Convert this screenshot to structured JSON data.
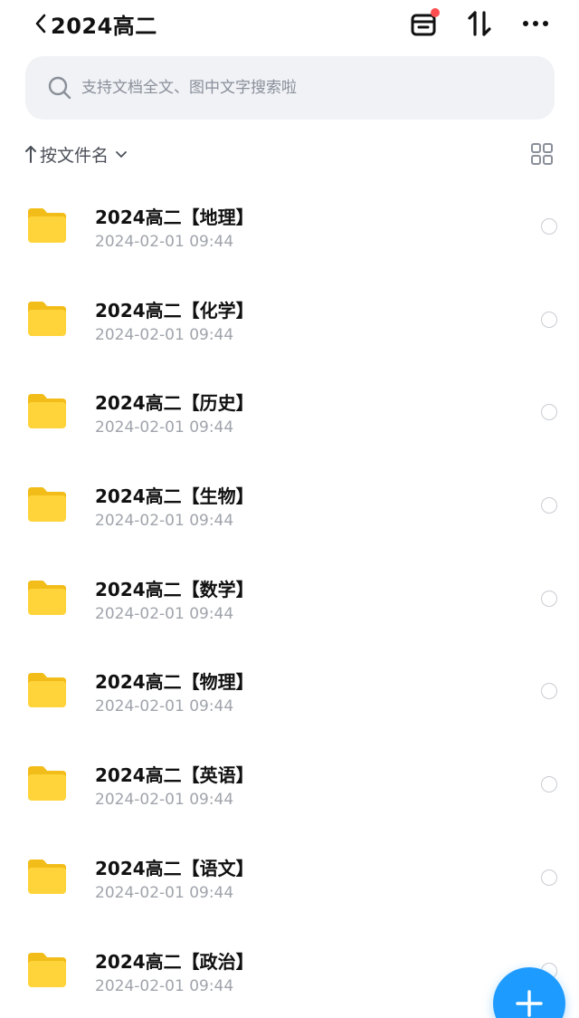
{
  "header": {
    "title": "2024高二",
    "icons": [
      "back-icon",
      "basket-icon",
      "sort-toggle-icon",
      "more-icon"
    ],
    "badge_color": "#ff4d4f"
  },
  "search": {
    "placeholder": "支持文档全文、图中文字搜索啦"
  },
  "sort": {
    "label": "按文件名"
  },
  "files": [
    {
      "name": "2024高二【地理】",
      "date": "2024-02-01 09:44"
    },
    {
      "name": "2024高二【化学】",
      "date": "2024-02-01 09:44"
    },
    {
      "name": "2024高二【历史】",
      "date": "2024-02-01 09:44"
    },
    {
      "name": "2024高二【生物】",
      "date": "2024-02-01 09:44"
    },
    {
      "name": "2024高二【数学】",
      "date": "2024-02-01 09:44"
    },
    {
      "name": "2024高二【物理】",
      "date": "2024-02-01 09:44"
    },
    {
      "name": "2024高二【英语】",
      "date": "2024-02-01 09:44"
    },
    {
      "name": "2024高二【语文】",
      "date": "2024-02-01 09:44"
    },
    {
      "name": "2024高二【政治】",
      "date": "2024-02-01 09:44"
    }
  ],
  "colors": {
    "accent": "#1e9bff",
    "folder": "#ffd43a",
    "search_bg": "#f0f2f6"
  }
}
